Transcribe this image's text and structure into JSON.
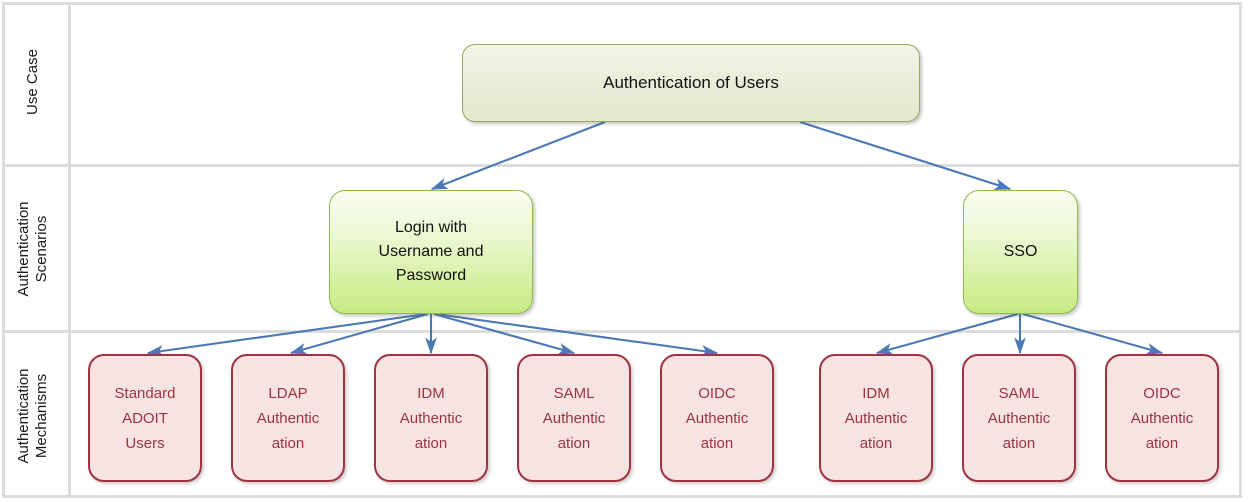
{
  "diagram": {
    "title": "Authentication of Users",
    "accent_arrow_color": "#4a79b4",
    "lanes": [
      {
        "id": "use-case",
        "label": "Use Case"
      },
      {
        "id": "authentication-scenarios",
        "label": "Authentication\nScenarios"
      },
      {
        "id": "authentication-mechanisms",
        "label": "Authentication\nMechanisms"
      }
    ],
    "nodes": {
      "use_case": {
        "id": "authentication-of-users",
        "label": "Authentication of Users",
        "fill": "#e8ecd7",
        "border": "#94ab5e",
        "text_color": "#111111"
      },
      "scenarios": [
        {
          "id": "login-with-username-and-password",
          "label": "Login with\nUsername and\nPassword",
          "fill": "#d3ef99",
          "border": "#8fb94e",
          "text_color": "#111111"
        },
        {
          "id": "sso",
          "label": "SSO",
          "fill": "#d3ef99",
          "border": "#8fb94e",
          "text_color": "#111111"
        }
      ],
      "mechanisms": [
        {
          "id": "standard-adoit-users",
          "label": "Standard\nADOIT\nUsers",
          "parent": "login-with-username-and-password",
          "fill": "#f6e3e2",
          "border": "#9d3440",
          "text_color": "#9d3440"
        },
        {
          "id": "ldap-authentication-left",
          "label": "LDAP\nAuthentic\nation",
          "parent": "login-with-username-and-password",
          "fill": "#f6e3e2",
          "border": "#9d3440",
          "text_color": "#9d3440"
        },
        {
          "id": "idm-authentication-left",
          "label": "IDM\nAuthentic\nation",
          "parent": "login-with-username-and-password",
          "fill": "#f6e3e2",
          "border": "#9d3440",
          "text_color": "#9d3440"
        },
        {
          "id": "saml-authentication-left",
          "label": "SAML\nAuthentic\nation",
          "parent": "login-with-username-and-password",
          "fill": "#f6e3e2",
          "border": "#9d3440",
          "text_color": "#9d3440"
        },
        {
          "id": "oidc-authentication-left",
          "label": "OIDC\nAuthentic\nation",
          "parent": "login-with-username-and-password",
          "fill": "#f6e3e2",
          "border": "#9d3440",
          "text_color": "#9d3440"
        },
        {
          "id": "idm-authentication-sso",
          "label": "IDM\nAuthentic\nation",
          "parent": "sso",
          "fill": "#f6e3e2",
          "border": "#9d3440",
          "text_color": "#9d3440"
        },
        {
          "id": "saml-authentication-sso",
          "label": "SAML\nAuthentic\nation",
          "parent": "sso",
          "fill": "#f6e3e2",
          "border": "#9d3440",
          "text_color": "#9d3440"
        },
        {
          "id": "oidc-authentication-sso",
          "label": "OIDC\nAuthentic\nation",
          "parent": "sso",
          "fill": "#f6e3e2",
          "border": "#9d3440",
          "text_color": "#9d3440"
        }
      ]
    },
    "edges": [
      {
        "from": "authentication-of-users",
        "to": "login-with-username-and-password"
      },
      {
        "from": "authentication-of-users",
        "to": "sso"
      },
      {
        "from": "login-with-username-and-password",
        "to": "standard-adoit-users"
      },
      {
        "from": "login-with-username-and-password",
        "to": "ldap-authentication-left"
      },
      {
        "from": "login-with-username-and-password",
        "to": "idm-authentication-left"
      },
      {
        "from": "login-with-username-and-password",
        "to": "saml-authentication-left"
      },
      {
        "from": "login-with-username-and-password",
        "to": "oidc-authentication-left"
      },
      {
        "from": "sso",
        "to": "idm-authentication-sso"
      },
      {
        "from": "sso",
        "to": "saml-authentication-sso"
      },
      {
        "from": "sso",
        "to": "oidc-authentication-sso"
      }
    ]
  }
}
